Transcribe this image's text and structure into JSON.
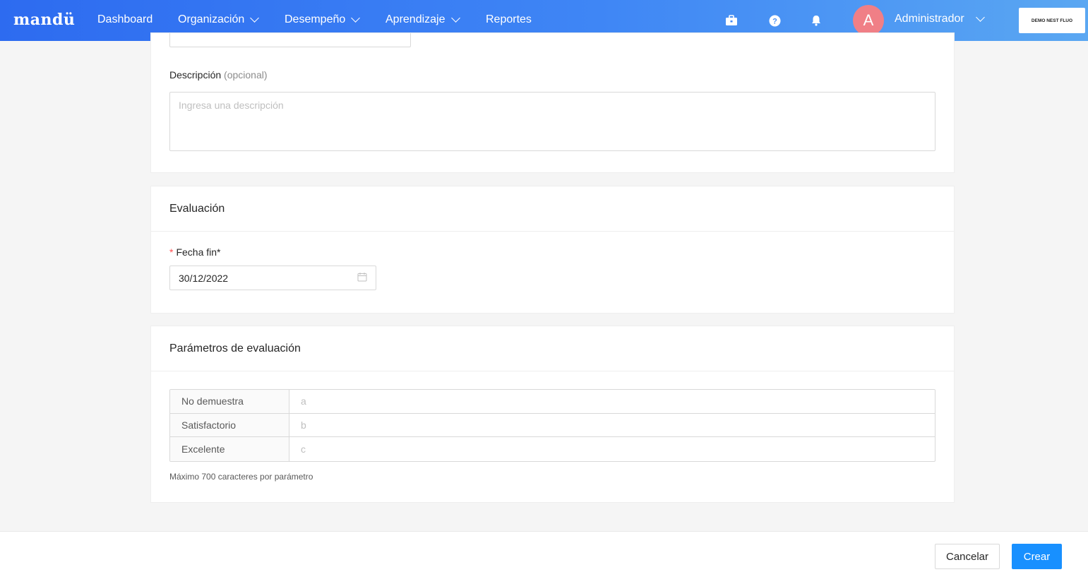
{
  "nav": {
    "logo": "mandü",
    "items": [
      {
        "label": "Dashboard"
      },
      {
        "label": "Organización"
      },
      {
        "label": "Desempeño"
      },
      {
        "label": "Aprendizaje"
      },
      {
        "label": "Reportes"
      }
    ],
    "avatar_letter": "A",
    "user_label": "Administrador",
    "company_label": "DEMO NEST FLUO"
  },
  "info_card": {
    "description_label": "Descripción",
    "description_optional": "(opcional)",
    "description_placeholder": "Ingresa una descripción"
  },
  "evaluation_card": {
    "title": "Evaluación",
    "end_date_required_mark": "*",
    "end_date_label": "Fecha fin*",
    "end_date_value": "30/12/2022"
  },
  "params_card": {
    "title": "Parámetros de evaluación",
    "rows": [
      {
        "level": "No demuestra",
        "value": "a"
      },
      {
        "level": "Satisfactorio",
        "value": "b"
      },
      {
        "level": "Excelente",
        "value": "c"
      }
    ],
    "hint": "Máximo 700 caracteres por parámetro"
  },
  "footer": {
    "cancel_label": "Cancelar",
    "create_label": "Crear"
  },
  "colors": {
    "nav_gradient_start": "#2d6bf0",
    "nav_gradient_end": "#5aa7f2",
    "primary": "#1890ff",
    "avatar": "#f07f86",
    "required": "#ff4d4f"
  },
  "icons": [
    "briefcase-icon",
    "help-icon",
    "bell-icon",
    "chevron-down-icon",
    "calendar-icon"
  ]
}
